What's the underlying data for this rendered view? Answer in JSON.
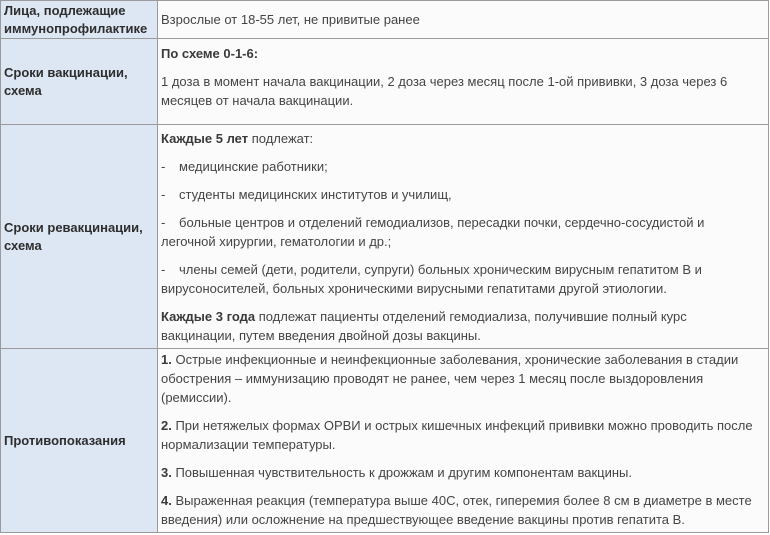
{
  "rows": [
    {
      "label": "Лица, подлежащие иммунопрофилактике",
      "content": "Взрослые от 18-55 лет, не привитые ранее"
    },
    {
      "label": "Сроки вакцинации, схема",
      "scheme_title": "По схеме 0-1-6:",
      "scheme_text": "1 доза в момент начала вакцинации, 2 доза через месяц после 1-ой прививки, 3 доза через 6 месяцев от начала вакцинации."
    },
    {
      "label": "Сроки ревакцинации, схема",
      "every5_bold": "Каждые 5 лет",
      "every5_rest": " подлежат:",
      "items": [
        "медицинские работники;",
        "студенты медицинских институтов и училищ,",
        "больные центров и отделений гемодиализов, пересадки почки, сердечно-сосудистой и легочной хирургии, гематологии и др.;",
        "члены семей (дети, родители, супруги) больных хроническим вирусным гепатитом В и вирусоносителей, больных хроническими вирусными гепатитами другой этиологии."
      ],
      "every3_bold": "Каждые 3 года",
      "every3_rest": " подлежат пациенты отделений гемодиализа, получившие полный курс вакцинации, путем введения двойной дозы вакцины."
    },
    {
      "label": "Противопоказания",
      "items": [
        {
          "num": "1.",
          "text": " Острые инфекционные и неинфекционные заболевания, хронические заболевания в стадии обострения – иммунизацию проводят не ранее, чем через 1 месяц после выздоровления (ремиссии)."
        },
        {
          "num": "2.",
          "text": " При нетяжелых формах ОРВИ и острых кишечных инфекций прививки можно проводить после нормализации температуры."
        },
        {
          "num": "3.",
          "text": " Повышенная чувствительность к дрожжам и другим компонентам вакцины."
        },
        {
          "num": "4.",
          "text": " Выраженная реакция (температура выше 40С, отек, гиперемия более 8 см в диаметре в месте введения) или осложнение на предшествующее введение вакцины против гепатита В."
        }
      ]
    }
  ]
}
